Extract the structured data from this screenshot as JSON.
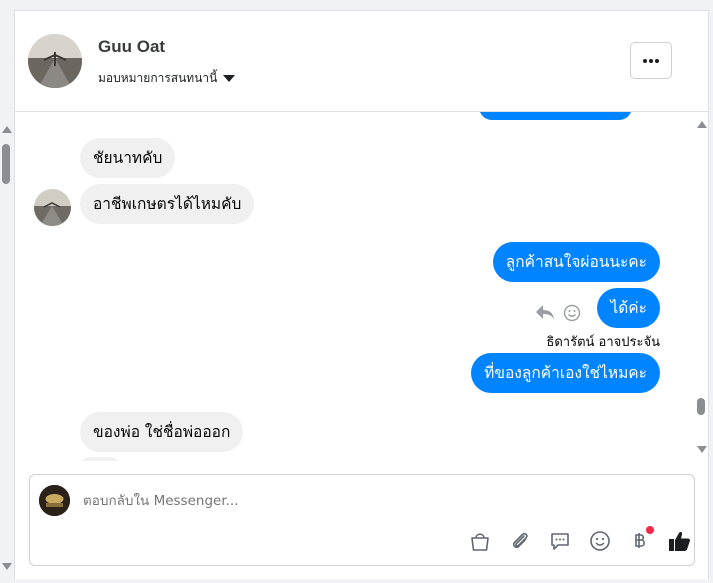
{
  "header": {
    "contact_name": "Guu Oat",
    "assign_label": "มอบหมายการสนทนานี้",
    "more_label": "•••"
  },
  "messages": [
    {
      "dir": "in",
      "text": "ชัยนาทคับ"
    },
    {
      "dir": "in",
      "text": "อาชีพเกษตรได้ไหมคับ"
    },
    {
      "dir": "out",
      "text": "ลูกค้าสนใจผ่อนนะคะ"
    },
    {
      "dir": "out",
      "text": "ได้ค่ะ"
    },
    {
      "dir": "out",
      "text": "ที่ของลูกค้าเองใช่ไหมคะ"
    },
    {
      "dir": "in",
      "text": "ของพ่อ ใช่ชื่อพ่อออก"
    }
  ],
  "sender_name": "ธิดารัตน์ อาจประจัน",
  "composer": {
    "placeholder": "ตอบกลับใน Messenger..."
  },
  "icons": [
    "more-icon",
    "reply-icon",
    "emoji-react-icon",
    "shopping-bag-icon",
    "paperclip-icon",
    "message-bubble-icon",
    "emoji-icon",
    "baht-icon",
    "thumbs-up-icon"
  ],
  "colors": {
    "outgoing_bubble": "#0084ff",
    "incoming_bubble": "#f0f0f0",
    "notification_dot": "#f02849"
  }
}
